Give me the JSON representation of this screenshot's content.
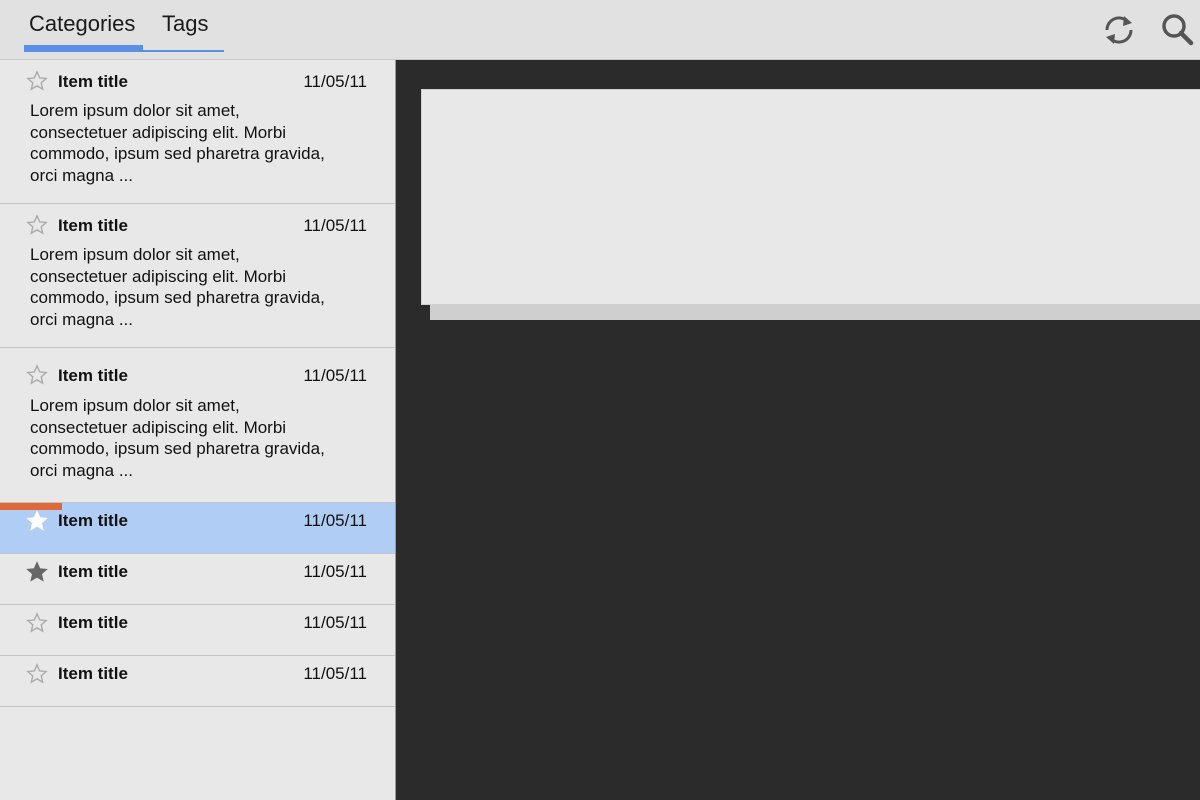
{
  "tabs": {
    "categories": "Categories",
    "tags": "Tags"
  },
  "toolbar": {
    "refresh_icon": "refresh-icon",
    "search_icon": "search-icon"
  },
  "colors": {
    "accent": "#5a8fe6",
    "selected_row": "#b0cdf5",
    "progress": "#e0693a",
    "content_bg": "#2b2b2b"
  },
  "list": {
    "items": [
      {
        "title": "Item title",
        "date": "11/05/11",
        "starred": false,
        "body": "Lorem ipsum dolor sit amet, consectetuer adipiscing elit. Morbi commodo, ipsum sed pharetra gravida, orci magna ..."
      },
      {
        "title": "Item title",
        "date": "11/05/11",
        "starred": false,
        "body": "Lorem ipsum dolor sit amet, consectetuer adipiscing elit. Morbi commodo, ipsum sed pharetra gravida, orci magna ..."
      },
      {
        "title": "Item title",
        "date": "11/05/11",
        "starred": false,
        "body": "Lorem ipsum dolor sit amet, consectetuer adipiscing elit. Morbi commodo, ipsum sed pharetra gravida, orci magna ..."
      },
      {
        "title": "Item title",
        "date": "11/05/11",
        "starred": false,
        "selected": true
      },
      {
        "title": "Item title",
        "date": "11/05/11",
        "starred": true
      },
      {
        "title": "Item title",
        "date": "11/05/11",
        "starred": false
      },
      {
        "title": "Item title",
        "date": "11/05/11",
        "starred": false
      }
    ]
  }
}
